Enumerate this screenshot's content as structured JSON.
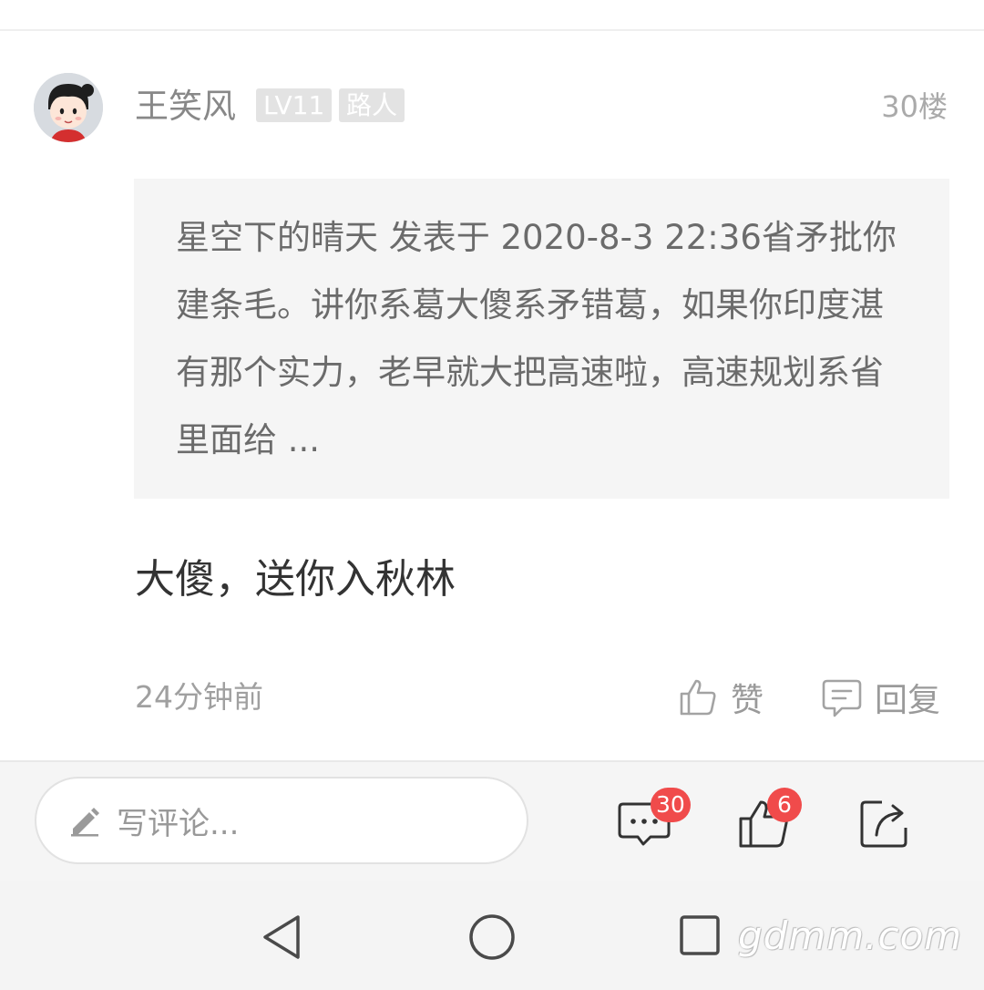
{
  "comment": {
    "username": "王笑风",
    "level_badge": "LV11",
    "role_badge": "路人",
    "floor": "30楼",
    "quote": "星空下的晴天 发表于 2020-8-3 22:36省矛批你建条毛。讲你系葛大傻系矛错葛，如果你印度湛有那个实力，老早就大把高速啦，高速规划系省里面给 ...",
    "reply": "大傻，送你入秋林",
    "time": "24分钟前",
    "like_label": "赞",
    "reply_label": "回复"
  },
  "input_bar": {
    "placeholder": "写评论...",
    "comment_count": "30",
    "like_count": "6"
  },
  "watermark": "gdmm.com",
  "icons": {
    "avatar": "cartoon-avatar",
    "like": "thumb-up-icon",
    "reply": "comment-bubble-icon",
    "edit": "pencil-icon",
    "comments": "comment-icon",
    "likes": "thumb-up-icon",
    "share": "share-icon",
    "nav_back": "triangle-back-icon",
    "nav_home": "circle-home-icon",
    "nav_recent": "square-recent-icon"
  },
  "colors": {
    "badge_red": "#f04b4b",
    "meta_gray": "#a0a0a0",
    "text_dark": "#333333"
  }
}
